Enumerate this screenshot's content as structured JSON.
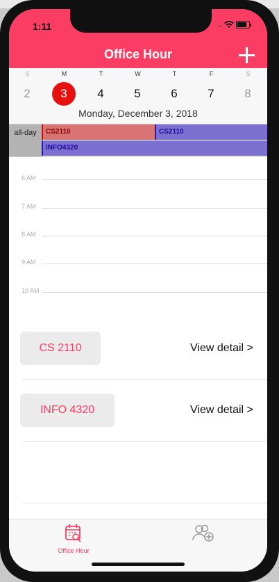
{
  "status": {
    "time": "1:11",
    "signal": "...."
  },
  "header": {
    "title": "Office Hour"
  },
  "week": {
    "days": [
      {
        "letter": "S",
        "num": "2",
        "weekend": true,
        "selected": false
      },
      {
        "letter": "M",
        "num": "3",
        "weekend": false,
        "selected": true
      },
      {
        "letter": "T",
        "num": "4",
        "weekend": false,
        "selected": false
      },
      {
        "letter": "W",
        "num": "5",
        "weekend": false,
        "selected": false
      },
      {
        "letter": "T",
        "num": "6",
        "weekend": false,
        "selected": false
      },
      {
        "letter": "F",
        "num": "7",
        "weekend": false,
        "selected": false
      },
      {
        "letter": "S",
        "num": "8",
        "weekend": true,
        "selected": false
      }
    ],
    "date_label": "Monday, December 3, 2018"
  },
  "allday": {
    "label": "all-day",
    "events": [
      "CS2110",
      "CS2110",
      "INFO4320"
    ]
  },
  "timeline": {
    "hours": [
      "6 AM",
      "7 AM",
      "8 AM",
      "9 AM",
      "10 AM"
    ]
  },
  "courses": [
    {
      "name": "CS 2110",
      "link": "View detail >"
    },
    {
      "name": "INFO 4320",
      "link": "View detail >"
    }
  ],
  "tabbar": {
    "tab1_label": "Office Hour"
  },
  "colors": {
    "accent": "#fc3d63",
    "selected_day": "#e8100e",
    "event_red": "#d97272",
    "event_purple": "#7b6fd0"
  }
}
